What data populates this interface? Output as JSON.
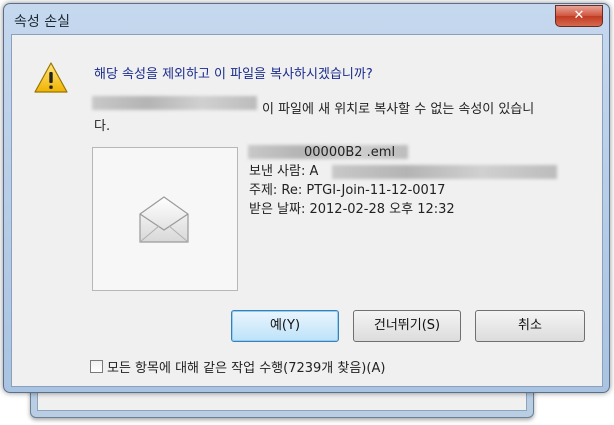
{
  "window": {
    "title": "속성 손실",
    "close_label": "✕"
  },
  "dialog": {
    "question": "해당 속성을 제외하고 이 파일을 복사하시겠습니까?",
    "message_tail": "이 파일에 새 위치로 복사할 수 없는 속성이 있습니",
    "message_wrap": "다.",
    "file": {
      "name_partial": "00000B2   .eml",
      "sender_label": "보낸 사람: A",
      "subject": "주제: Re: PTGI-Join-11-12-0017",
      "received": "받은 날짜: 2012-02-28 오후 12:32"
    }
  },
  "buttons": {
    "yes": "예(Y)",
    "skip": "건너뛰기(S)",
    "cancel": "취소"
  },
  "checkbox": {
    "label": "모든 항목에 대해 같은 작업 수행(7239개 찾음)(A)"
  },
  "colors": {
    "question_text": "#1a2c8c",
    "default_button": "#bde3f9"
  }
}
